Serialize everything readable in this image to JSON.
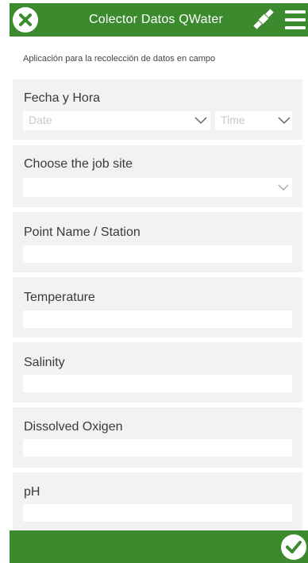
{
  "header": {
    "title": "Colector Datos QWater"
  },
  "subtitle": "Aplicación para la recolección de datos en campo",
  "fields": {
    "datetime": {
      "label": "Fecha y Hora",
      "date_placeholder": "Date",
      "time_placeholder": "Time"
    },
    "job_site": {
      "label": "Choose the job site",
      "value": ""
    },
    "point_name": {
      "label": "Point Name / Station",
      "value": ""
    },
    "temperature": {
      "label": "Temperature",
      "value": ""
    },
    "salinity": {
      "label": "Salinity",
      "value": ""
    },
    "dissolved_oxygen": {
      "label": "Dissolved Oxigen",
      "value": ""
    },
    "ph": {
      "label": "pH",
      "value": ""
    }
  },
  "colors": {
    "brand_green": "#3c8a2e",
    "card_bg": "#f2f2f2",
    "field_bg": "#ffffff"
  },
  "icons": {
    "close": "close-circle-icon",
    "satellite": "satellite-icon",
    "menu": "hamburger-menu-icon",
    "submit": "checkmark-circle-icon"
  }
}
